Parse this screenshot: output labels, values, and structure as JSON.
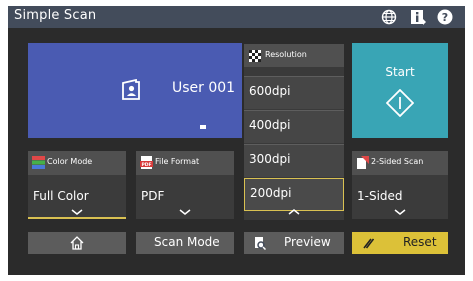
{
  "header": {
    "title": "Simple Scan",
    "icons": [
      "globe-icon",
      "info-icon",
      "help-icon"
    ]
  },
  "user": {
    "name": "User 001",
    "secondary": "-"
  },
  "start": {
    "label": "Start"
  },
  "tiles": {
    "color_mode": {
      "label": "Color Mode",
      "value": "Full Color"
    },
    "file_format": {
      "label": "File Format",
      "value": "PDF"
    },
    "two_sided": {
      "label": "2-Sided Scan",
      "value": "1-Sided"
    }
  },
  "resolution": {
    "label": "Resolution",
    "options": [
      "600dpi",
      "400dpi",
      "300dpi",
      "200dpi"
    ],
    "selected": "200dpi"
  },
  "bottom": {
    "scan_mode": "Scan Mode",
    "preview": "Preview",
    "reset": "Reset"
  },
  "colors": {
    "title_bar": "#434c5b",
    "user_panel": "#4a5bb2",
    "start": "#39a5b5",
    "accent": "#d9c152",
    "reset": "#dcc138"
  }
}
